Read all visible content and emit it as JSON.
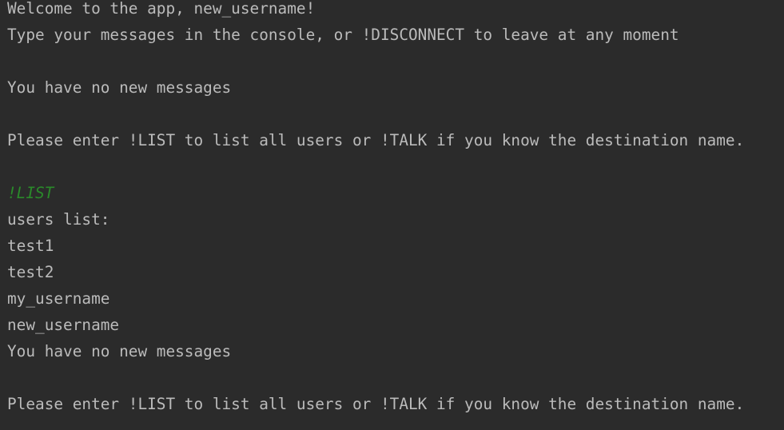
{
  "console": {
    "lines": [
      {
        "text": "Welcome to the app, new_username!",
        "kind": "output"
      },
      {
        "text": "Type your messages in the console, or !DISCONNECT to leave at any moment",
        "kind": "output"
      },
      {
        "text": "",
        "kind": "blank"
      },
      {
        "text": "You have no new messages",
        "kind": "output"
      },
      {
        "text": "",
        "kind": "blank"
      },
      {
        "text": "Please enter !LIST to list all users or !TALK if you know the destination name.",
        "kind": "output"
      },
      {
        "text": "",
        "kind": "blank"
      },
      {
        "text": "!LIST",
        "kind": "input"
      },
      {
        "text": "users list:",
        "kind": "output"
      },
      {
        "text": "test1",
        "kind": "output"
      },
      {
        "text": "test2",
        "kind": "output"
      },
      {
        "text": "my_username",
        "kind": "output"
      },
      {
        "text": "new_username",
        "kind": "output"
      },
      {
        "text": "You have no new messages",
        "kind": "output"
      },
      {
        "text": "",
        "kind": "blank"
      },
      {
        "text": "Please enter !LIST to list all users or !TALK if you know the destination name.",
        "kind": "output"
      }
    ]
  },
  "colors": {
    "background": "#2b2b2b",
    "output_text": "#bbbbbb",
    "user_input_text": "#2a8a2a"
  }
}
